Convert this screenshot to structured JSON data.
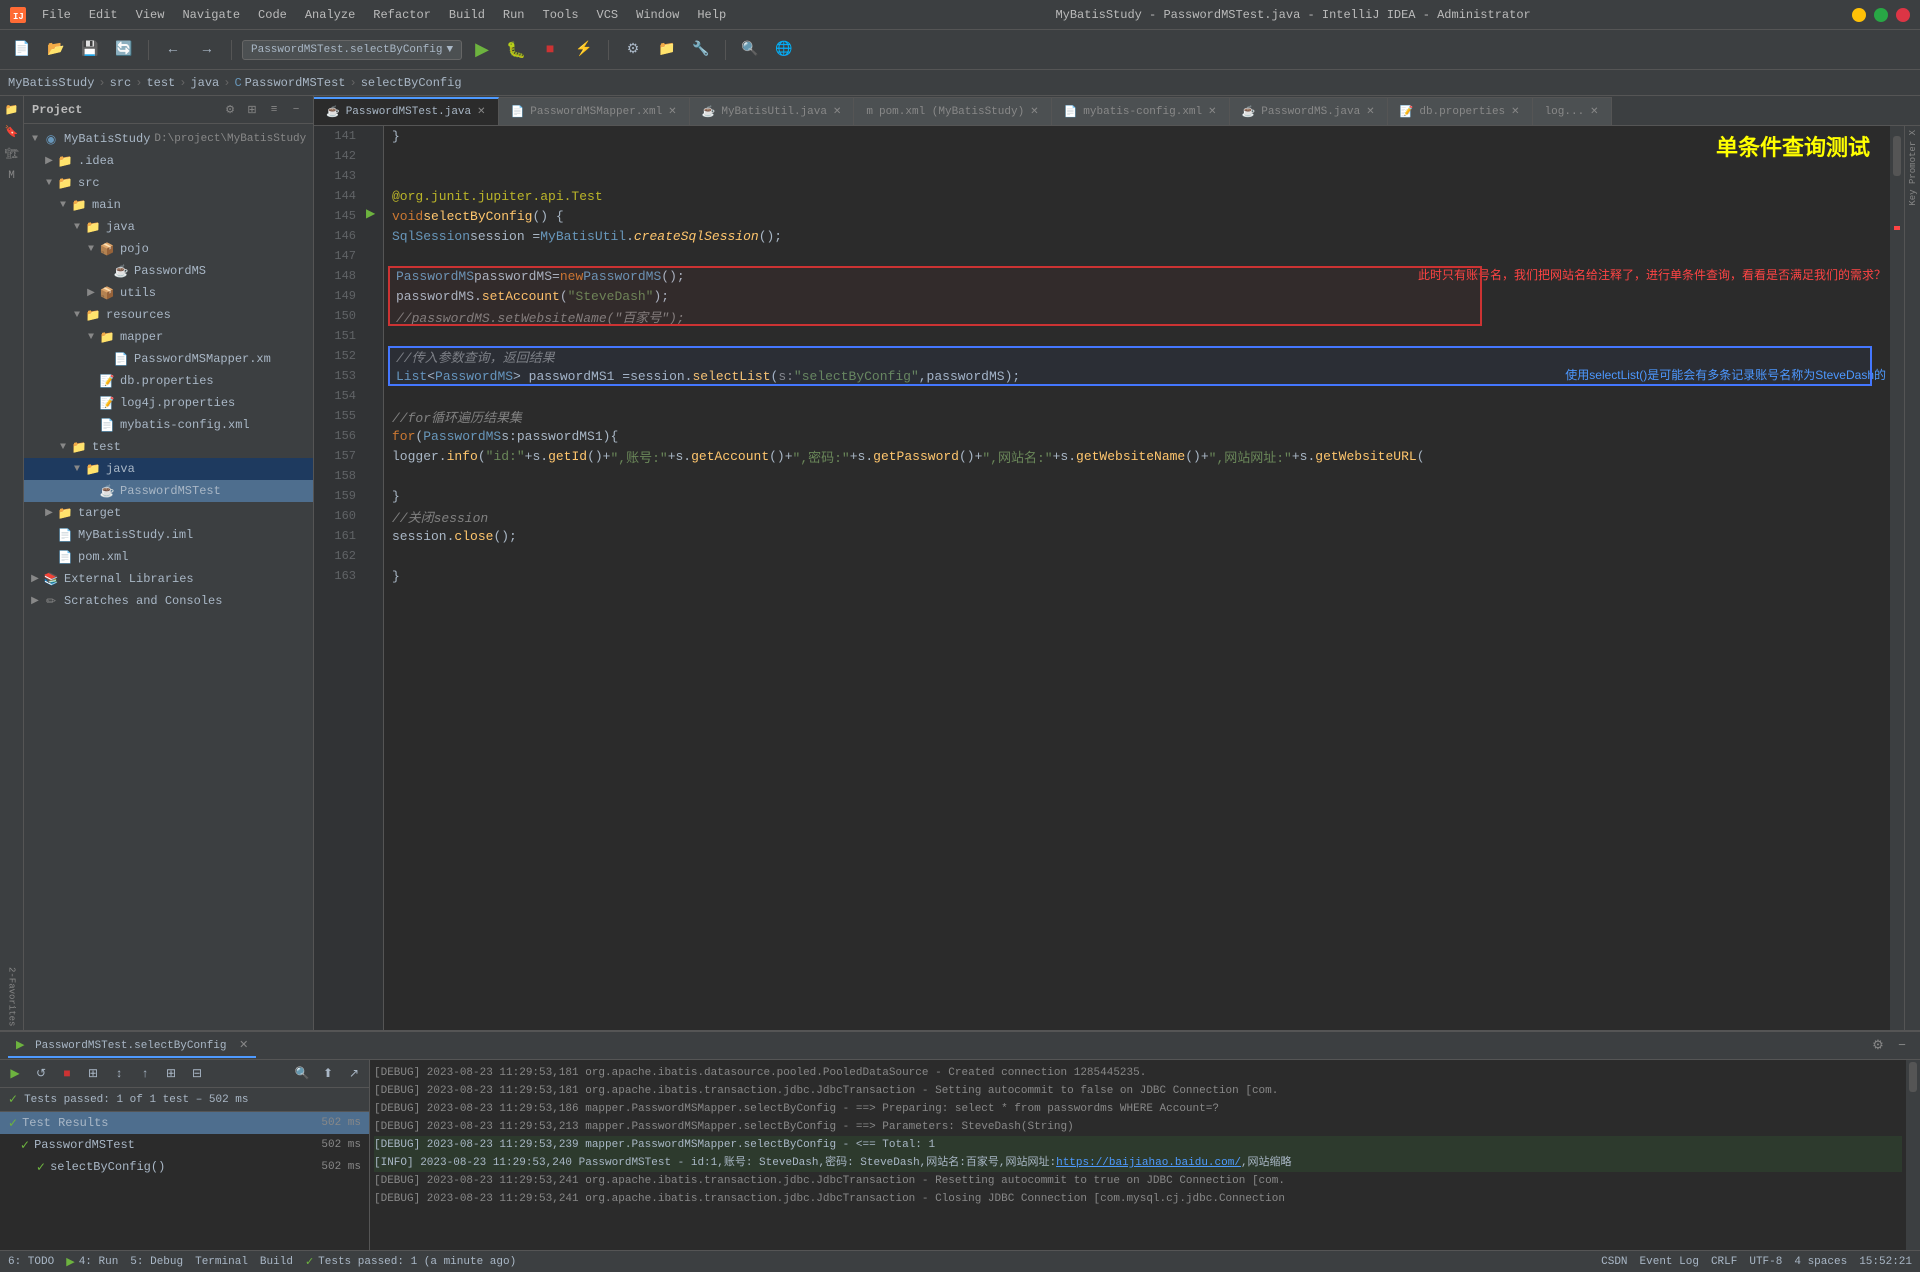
{
  "window": {
    "title": "MyBatisStudy - PasswordMSTest.java - IntelliJ IDEA - Administrator",
    "menu_items": [
      "File",
      "Edit",
      "View",
      "Navigate",
      "Code",
      "Analyze",
      "Refactor",
      "Build",
      "Run",
      "Tools",
      "VCS",
      "Window",
      "Help"
    ]
  },
  "breadcrumb": {
    "items": [
      "MyBatisStudy",
      "src",
      "test",
      "java",
      "PasswordMSTest",
      "selectByConfig"
    ]
  },
  "toolbar": {
    "run_config": "PasswordMSTest.selectByConfig"
  },
  "tabs": [
    {
      "label": "PasswordMSTest.java",
      "active": true,
      "icon": "java"
    },
    {
      "label": "PasswordMSMapper.xml",
      "active": false,
      "icon": "xml"
    },
    {
      "label": "MyBatisUtil.java",
      "active": false,
      "icon": "java"
    },
    {
      "label": "pom.xml (MyBatisStudy)",
      "active": false,
      "icon": "xml"
    },
    {
      "label": "mybatis-config.xml",
      "active": false,
      "icon": "xml"
    },
    {
      "label": "PasswordMS.java",
      "active": false,
      "icon": "java"
    },
    {
      "label": "db.properties",
      "active": false,
      "icon": "props"
    },
    {
      "label": "log...",
      "active": false,
      "icon": "props"
    }
  ],
  "project_tree": {
    "root": "MyBatisStudy",
    "items": [
      {
        "label": "MyBatisStudy",
        "level": 0,
        "type": "module",
        "expanded": true
      },
      {
        "label": ".idea",
        "level": 1,
        "type": "folder",
        "expanded": false
      },
      {
        "label": "src",
        "level": 1,
        "type": "folder",
        "expanded": true
      },
      {
        "label": "main",
        "level": 2,
        "type": "folder",
        "expanded": true
      },
      {
        "label": "java",
        "level": 3,
        "type": "folder",
        "expanded": true
      },
      {
        "label": "pojo",
        "level": 4,
        "type": "folder",
        "expanded": true
      },
      {
        "label": "PasswordMS",
        "level": 5,
        "type": "java",
        "expanded": false
      },
      {
        "label": "utils",
        "level": 4,
        "type": "folder",
        "expanded": false
      },
      {
        "label": "resources",
        "level": 3,
        "type": "folder",
        "expanded": true
      },
      {
        "label": "mapper",
        "level": 4,
        "type": "folder",
        "expanded": true
      },
      {
        "label": "PasswordMSMapper.xm",
        "level": 5,
        "type": "xml"
      },
      {
        "label": "db.properties",
        "level": 4,
        "type": "props"
      },
      {
        "label": "log4j.properties",
        "level": 4,
        "type": "props"
      },
      {
        "label": "mybatis-config.xml",
        "level": 4,
        "type": "xml"
      },
      {
        "label": "test",
        "level": 2,
        "type": "folder",
        "expanded": true
      },
      {
        "label": "java",
        "level": 3,
        "type": "folder",
        "expanded": true
      },
      {
        "label": "PasswordMSTest",
        "level": 4,
        "type": "java-test",
        "selected": true
      },
      {
        "label": "target",
        "level": 1,
        "type": "folder",
        "expanded": false
      },
      {
        "label": "MyBatisStudy.iml",
        "level": 1,
        "type": "iml"
      },
      {
        "label": "pom.xml",
        "level": 1,
        "type": "xml"
      },
      {
        "label": "External Libraries",
        "level": 0,
        "type": "libs"
      },
      {
        "label": "Scratches and Consoles",
        "level": 0,
        "type": "scratches"
      }
    ]
  },
  "code": {
    "lines": [
      {
        "num": 141,
        "content": "    }"
      },
      {
        "num": 142,
        "content": ""
      },
      {
        "num": 143,
        "content": ""
      },
      {
        "num": 144,
        "content": "    @org.junit.jupiter.api.Test"
      },
      {
        "num": 145,
        "content": "    void selectByConfig() {",
        "has_run": true
      },
      {
        "num": 146,
        "content": "        SqlSession session =MyBatisUtil.createSqlSession();"
      },
      {
        "num": 147,
        "content": ""
      },
      {
        "num": 148,
        "content": "        PasswordMS passwordMS=new PasswordMS();",
        "red_box": true
      },
      {
        "num": 149,
        "content": "        passwordMS.setAccount(\"SteveDash\");",
        "red_box": true
      },
      {
        "num": 150,
        "content": "        //passwordMS.setWebsiteName(\"百家号\");",
        "red_box": true
      },
      {
        "num": 151,
        "content": ""
      },
      {
        "num": 152,
        "content": "        //传入参数查询，返回结果",
        "blue_box": true
      },
      {
        "num": 153,
        "content": "        List<PasswordMS> passwordMS1 =session.selectList( s: \"selectByConfig\",passwordMS);",
        "blue_box": true
      },
      {
        "num": 154,
        "content": ""
      },
      {
        "num": 155,
        "content": "        //for循环遍历结果集"
      },
      {
        "num": 156,
        "content": "        for (PasswordMS s:passwordMS1){"
      },
      {
        "num": 157,
        "content": "            logger.info(\"id:\"+s.getId()+\",账号:\"+s.getAccount()+\",密码:\"+s.getPassword()+\",网站名:\"+s.getWebsiteName()+\",网站网址:\"+s.getWebsiteURL("
      },
      {
        "num": 158,
        "content": ""
      },
      {
        "num": 159,
        "content": "        }"
      },
      {
        "num": 160,
        "content": "        //关闭session"
      },
      {
        "num": 161,
        "content": "        session.close();"
      },
      {
        "num": 162,
        "content": ""
      },
      {
        "num": 163,
        "content": "    }"
      }
    ],
    "big_title": "单条件查询测试",
    "red_annotation": "此时只有账号名，我们把网站名给注释了，进行单条件查询，看看是否满足我们的需求？",
    "blue_annotation": "使用selectList()是可能会有多条记录账号名称为SteveDash的"
  },
  "bottom_panel": {
    "tab_label": "Run",
    "run_config": "PasswordMSTest.selectByConfig",
    "test_status": "Tests passed: 1 of 1 test – 502 ms",
    "test_results": {
      "header": "Test Results",
      "total_time": "502 ms",
      "items": [
        {
          "label": "PasswordMSTest",
          "time": "502 ms",
          "status": "pass"
        },
        {
          "label": "selectByConfig()",
          "time": "502 ms",
          "status": "pass"
        }
      ]
    },
    "log_lines": [
      {
        "type": "debug",
        "text": "[DEBUG] 2023-08-23 11:29:53,181 org.apache.ibatis.datasource.pooled.PooledDataSource - Created connection 1285445235."
      },
      {
        "type": "debug",
        "text": "[DEBUG] 2023-08-23 11:29:53,181 org.apache.ibatis.transaction.jdbc.JdbcTransaction - Setting autocommit to false on JDBC Connection [com."
      },
      {
        "type": "debug",
        "text": "[DEBUG] 2023-08-23 11:29:53,186 mapper.PasswordMSMapper.selectByConfig - ==>  Preparing: select * from passwordms WHERE Account=?"
      },
      {
        "type": "debug",
        "text": "[DEBUG] 2023-08-23 11:29:53,213 mapper.PasswordMSMapper.selectByConfig - ==>  Parameters: SteveDash(String)"
      },
      {
        "type": "debug-green",
        "text": "[DEBUG] 2023-08-23 11:29:53,239 mapper.PasswordMSMapper.selectByConfig - <==    Total: 1"
      },
      {
        "type": "info-green",
        "text": "[INFO] 2023-08-23 11:29:53,240 PasswordMSTest - id:1,账号: SteveDash,密码: SteveDash,网站名:百家号,网站网址:https://baijiahao.baidu.com/,网站缩略"
      },
      {
        "type": "debug",
        "text": "[DEBUG] 2023-08-23 11:29:53,241 org.apache.ibatis.transaction.jdbc.JdbcTransaction - Resetting autocommit to true on JDBC Connection [com."
      },
      {
        "type": "debug",
        "text": "[DEBUG] 2023-08-23 11:29:53,241 org.apache.ibatis.transaction.jdbc.JdbcTransaction - Closing JDBC Connection [com.mysql.cj.jdbc.Connection"
      }
    ]
  },
  "status_bar": {
    "tests_passed": "Tests passed: 1 (a minute ago)",
    "todo": "6: TODO",
    "run": "4: Run",
    "debug": "5: Debug",
    "terminal": "Terminal",
    "build": "Build",
    "time": "15:52:21",
    "encoding": "UTF-8",
    "line_sep": "CRLF",
    "indent": "4 spaces",
    "event_log": "Event Log",
    "csdn": "CSDN"
  }
}
